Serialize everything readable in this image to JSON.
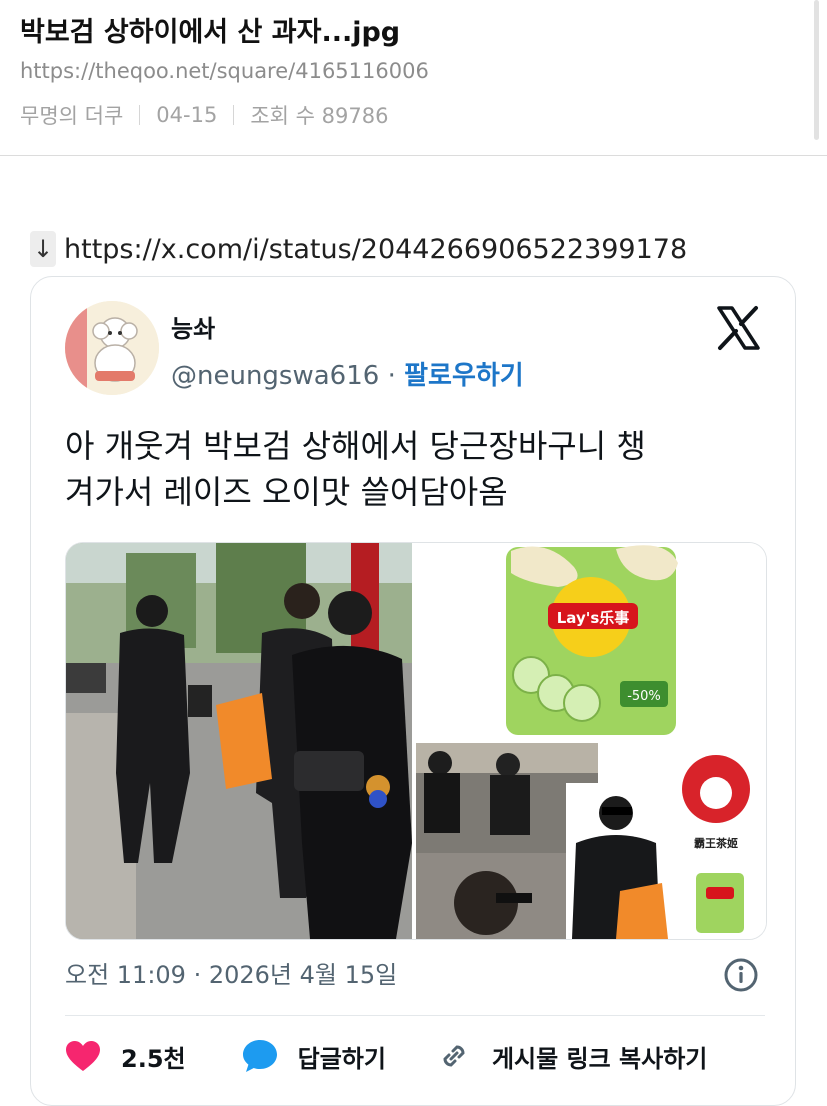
{
  "post": {
    "title": "박보검 상하이에서 산 과자...jpg",
    "url": "https://theqoo.net/square/4165116006",
    "author": "무명의 더쿠",
    "date": "04-15",
    "views": "조회 수 89786"
  },
  "embed": {
    "arrow": "↓",
    "link": "https://x.com/i/status/2044266906522399178"
  },
  "tweet": {
    "display_name": "능솨",
    "handle": "@neungswa616",
    "dot": " · ",
    "follow_label": "팔로우하기",
    "text_line1": "아 개웃겨 박보검 상해에서 당근장바구니 챙",
    "text_line2": "겨가서 레이즈 오이맛 쓸어담아옴",
    "timestamp": "오전 11:09 · 2026년 4월 15일",
    "likes": "2.5천",
    "reply_label": "답글하기",
    "copy_link_label": "게시물 링크 복사하기",
    "chips_brand": "Lay's乐事",
    "chips_promo": "-50%",
    "tea_shop_label": "霸王茶姬"
  },
  "colors": {
    "heart": "#f6266f",
    "reply": "#1d9bf0",
    "link": "#1d76c8",
    "chips_bag": "#9fd45f",
    "bag_orange": "#f18a2a"
  },
  "icons": [
    "arrow-down-icon",
    "x-logo-icon",
    "info-icon",
    "heart-icon",
    "reply-bubble-icon",
    "link-icon"
  ]
}
